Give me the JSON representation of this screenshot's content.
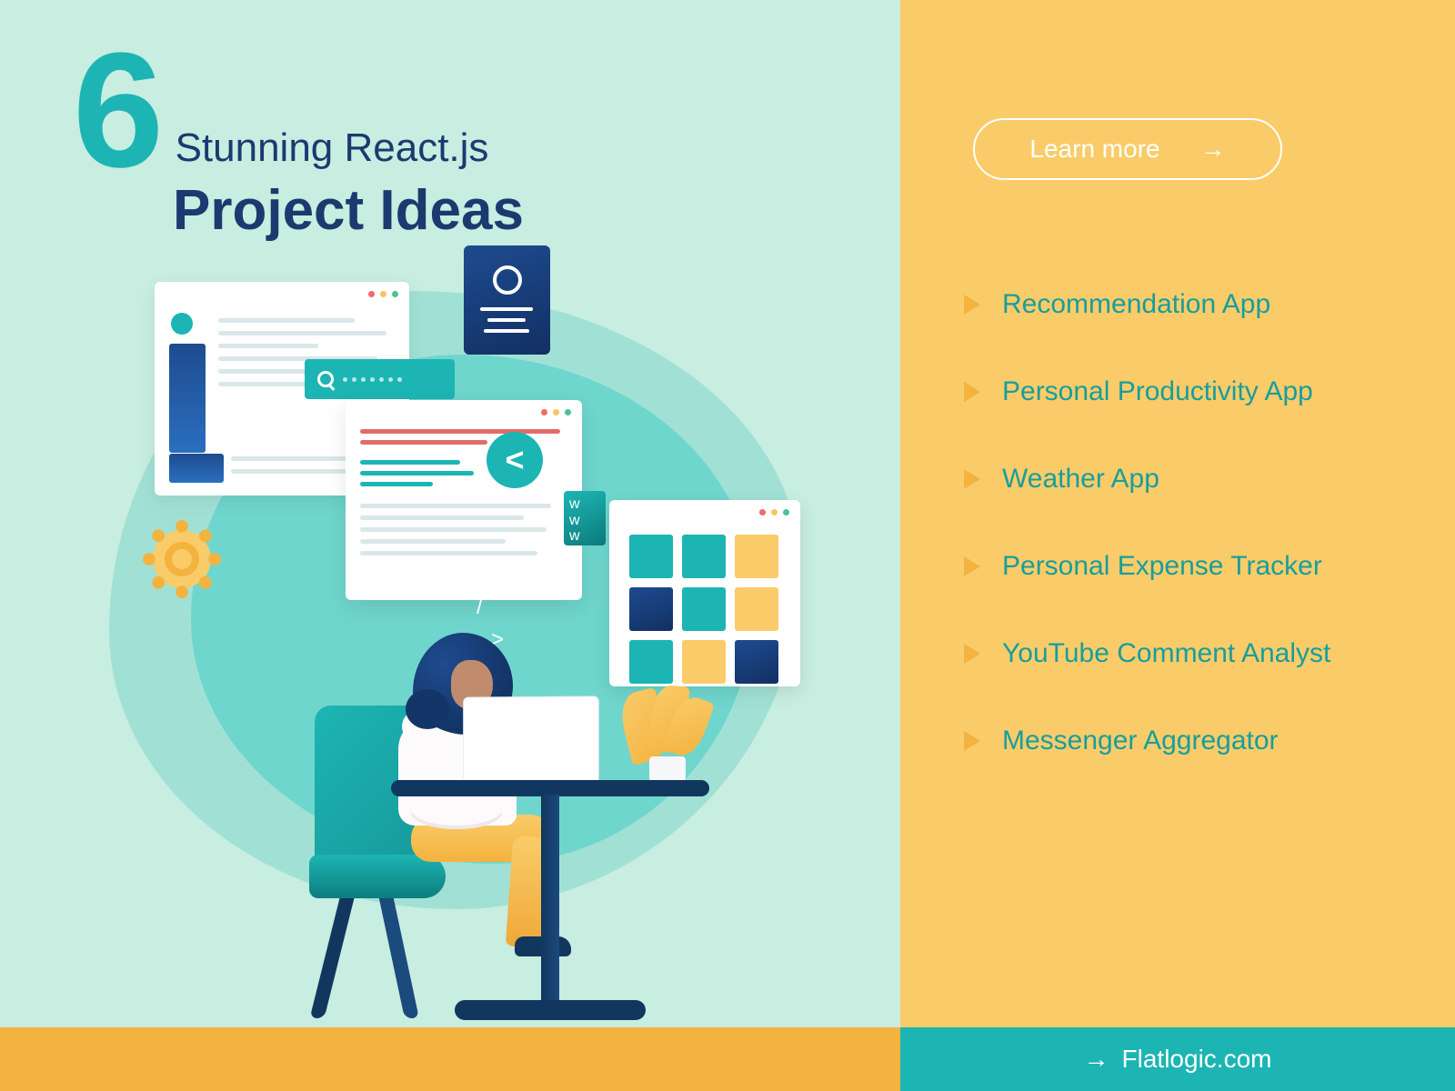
{
  "heading": {
    "number": "6",
    "line1": "Stunning React.js",
    "line2": "Project Ideas"
  },
  "cta": {
    "label": "Learn more"
  },
  "ideas": [
    "Recommendation App",
    "Personal Productivity App",
    "Weather App",
    "Personal Expense Tracker",
    "YouTube Comment Analyst",
    "Messenger Aggregator"
  ],
  "footer": {
    "brand": "Flatlogic.com"
  },
  "glyphs": {
    "angle1": "<",
    "angle2": ">",
    "slash": "/",
    "code": "<",
    "w": "w\nw\nw"
  }
}
